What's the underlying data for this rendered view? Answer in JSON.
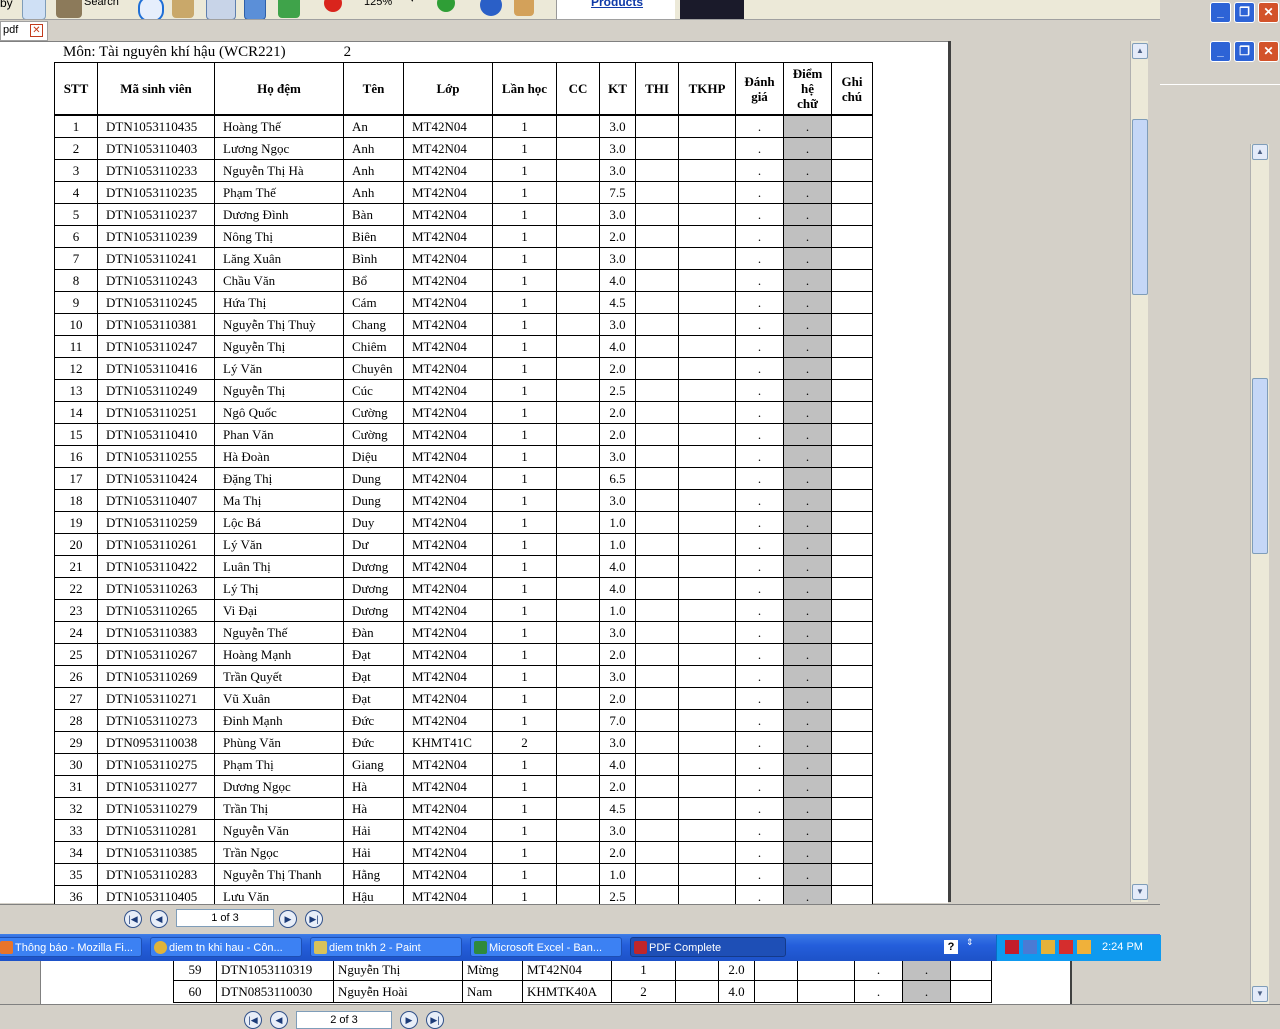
{
  "toolbar": {
    "left_fragment": "by",
    "search_label": "Search",
    "zoom": "125%",
    "products_link": "Products"
  },
  "doc_tab": {
    "label": "pdf",
    "close": "✕"
  },
  "document": {
    "subject": "Môn: Tài nguyên khí hậu (WCR221)",
    "page_number": "2",
    "headers": {
      "stt": "STT",
      "student_id": "Mã sinh viên",
      "surname": "Họ đệm",
      "name": "Tên",
      "class": "Lớp",
      "attempt": "Lần học",
      "cc": "CC",
      "kt": "KT",
      "thi": "THI",
      "tkhp": "TKHP",
      "rating_1": "Đánh",
      "rating_2": "giá",
      "letter_1": "Điểm",
      "letter_2": "hệ",
      "letter_3": "chữ",
      "note_1": "Ghi",
      "note_2": "chú"
    },
    "rows": [
      {
        "stt": "1",
        "id": "DTN1053110435",
        "surname": "Hoàng Thế",
        "name": "An",
        "class": "MT42N04",
        "attempt": "1",
        "kt": "3.0",
        "rating": ".",
        "letter": "."
      },
      {
        "stt": "2",
        "id": "DTN1053110403",
        "surname": "Lương Ngọc",
        "name": "Anh",
        "class": "MT42N04",
        "attempt": "1",
        "kt": "3.0",
        "rating": ".",
        "letter": "."
      },
      {
        "stt": "3",
        "id": "DTN1053110233",
        "surname": "Nguyễn Thị Hà",
        "name": "Anh",
        "class": "MT42N04",
        "attempt": "1",
        "kt": "3.0",
        "rating": ".",
        "letter": "."
      },
      {
        "stt": "4",
        "id": "DTN1053110235",
        "surname": "Phạm Thế",
        "name": "Anh",
        "class": "MT42N04",
        "attempt": "1",
        "kt": "7.5",
        "rating": ".",
        "letter": "."
      },
      {
        "stt": "5",
        "id": "DTN1053110237",
        "surname": "Dương Đình",
        "name": "Bàn",
        "class": "MT42N04",
        "attempt": "1",
        "kt": "3.0",
        "rating": ".",
        "letter": "."
      },
      {
        "stt": "6",
        "id": "DTN1053110239",
        "surname": "Nông Thị",
        "name": "Biên",
        "class": "MT42N04",
        "attempt": "1",
        "kt": "2.0",
        "rating": ".",
        "letter": "."
      },
      {
        "stt": "7",
        "id": "DTN1053110241",
        "surname": "Lăng Xuân",
        "name": "Bình",
        "class": "MT42N04",
        "attempt": "1",
        "kt": "3.0",
        "rating": ".",
        "letter": "."
      },
      {
        "stt": "8",
        "id": "DTN1053110243",
        "surname": "Chầu Văn",
        "name": "Bổ",
        "class": "MT42N04",
        "attempt": "1",
        "kt": "4.0",
        "rating": ".",
        "letter": "."
      },
      {
        "stt": "9",
        "id": "DTN1053110245",
        "surname": "Hứa Thị",
        "name": "Cám",
        "class": "MT42N04",
        "attempt": "1",
        "kt": "4.5",
        "rating": ".",
        "letter": "."
      },
      {
        "stt": "10",
        "id": "DTN1053110381",
        "surname": "Nguyễn Thị Thuỳ",
        "name": "Chang",
        "class": "MT42N04",
        "attempt": "1",
        "kt": "3.0",
        "rating": ".",
        "letter": "."
      },
      {
        "stt": "11",
        "id": "DTN1053110247",
        "surname": "Nguyễn Thị",
        "name": "Chiêm",
        "class": "MT42N04",
        "attempt": "1",
        "kt": "4.0",
        "rating": ".",
        "letter": "."
      },
      {
        "stt": "12",
        "id": "DTN1053110416",
        "surname": "Lý Văn",
        "name": "Chuyên",
        "class": "MT42N04",
        "attempt": "1",
        "kt": "2.0",
        "rating": ".",
        "letter": "."
      },
      {
        "stt": "13",
        "id": "DTN1053110249",
        "surname": "Nguyễn Thị",
        "name": "Cúc",
        "class": "MT42N04",
        "attempt": "1",
        "kt": "2.5",
        "rating": ".",
        "letter": "."
      },
      {
        "stt": "14",
        "id": "DTN1053110251",
        "surname": "Ngô Quốc",
        "name": "Cường",
        "class": "MT42N04",
        "attempt": "1",
        "kt": "2.0",
        "rating": ".",
        "letter": "."
      },
      {
        "stt": "15",
        "id": "DTN1053110410",
        "surname": "Phan Văn",
        "name": "Cường",
        "class": "MT42N04",
        "attempt": "1",
        "kt": "2.0",
        "rating": ".",
        "letter": "."
      },
      {
        "stt": "16",
        "id": "DTN1053110255",
        "surname": "Hà Đoàn",
        "name": "Diệu",
        "class": "MT42N04",
        "attempt": "1",
        "kt": "3.0",
        "rating": ".",
        "letter": "."
      },
      {
        "stt": "17",
        "id": "DTN1053110424",
        "surname": "Đặng Thị",
        "name": "Dung",
        "class": "MT42N04",
        "attempt": "1",
        "kt": "6.5",
        "rating": ".",
        "letter": "."
      },
      {
        "stt": "18",
        "id": "DTN1053110407",
        "surname": "Ma Thị",
        "name": "Dung",
        "class": "MT42N04",
        "attempt": "1",
        "kt": "3.0",
        "rating": ".",
        "letter": "."
      },
      {
        "stt": "19",
        "id": "DTN1053110259",
        "surname": "Lộc Bá",
        "name": "Duy",
        "class": "MT42N04",
        "attempt": "1",
        "kt": "1.0",
        "rating": ".",
        "letter": "."
      },
      {
        "stt": "20",
        "id": "DTN1053110261",
        "surname": "Lý Văn",
        "name": "Dư",
        "class": "MT42N04",
        "attempt": "1",
        "kt": "1.0",
        "rating": ".",
        "letter": "."
      },
      {
        "stt": "21",
        "id": "DTN1053110422",
        "surname": "Luân Thị",
        "name": "Dương",
        "class": "MT42N04",
        "attempt": "1",
        "kt": "4.0",
        "rating": ".",
        "letter": "."
      },
      {
        "stt": "22",
        "id": "DTN1053110263",
        "surname": "Lý Thị",
        "name": "Dương",
        "class": "MT42N04",
        "attempt": "1",
        "kt": "4.0",
        "rating": ".",
        "letter": "."
      },
      {
        "stt": "23",
        "id": "DTN1053110265",
        "surname": "Vi Đại",
        "name": "Dương",
        "class": "MT42N04",
        "attempt": "1",
        "kt": "1.0",
        "rating": ".",
        "letter": "."
      },
      {
        "stt": "24",
        "id": "DTN1053110383",
        "surname": "Nguyễn Thế",
        "name": "Đàn",
        "class": "MT42N04",
        "attempt": "1",
        "kt": "3.0",
        "rating": ".",
        "letter": "."
      },
      {
        "stt": "25",
        "id": "DTN1053110267",
        "surname": "Hoàng Mạnh",
        "name": "Đạt",
        "class": "MT42N04",
        "attempt": "1",
        "kt": "2.0",
        "rating": ".",
        "letter": "."
      },
      {
        "stt": "26",
        "id": "DTN1053110269",
        "surname": "Trần Quyết",
        "name": "Đạt",
        "class": "MT42N04",
        "attempt": "1",
        "kt": "3.0",
        "rating": ".",
        "letter": "."
      },
      {
        "stt": "27",
        "id": "DTN1053110271",
        "surname": "Vũ Xuân",
        "name": "Đạt",
        "class": "MT42N04",
        "attempt": "1",
        "kt": "2.0",
        "rating": ".",
        "letter": "."
      },
      {
        "stt": "28",
        "id": "DTN1053110273",
        "surname": "Đinh Mạnh",
        "name": "Đức",
        "class": "MT42N04",
        "attempt": "1",
        "kt": "7.0",
        "rating": ".",
        "letter": "."
      },
      {
        "stt": "29",
        "id": "DTN0953110038",
        "surname": "Phùng Văn",
        "name": "Đức",
        "class": "KHMT41C",
        "attempt": "2",
        "kt": "3.0",
        "rating": ".",
        "letter": "."
      },
      {
        "stt": "30",
        "id": "DTN1053110275",
        "surname": "Phạm Thị",
        "name": "Giang",
        "class": "MT42N04",
        "attempt": "1",
        "kt": "4.0",
        "rating": ".",
        "letter": "."
      },
      {
        "stt": "31",
        "id": "DTN1053110277",
        "surname": "Dương Ngọc",
        "name": "Hà",
        "class": "MT42N04",
        "attempt": "1",
        "kt": "2.0",
        "rating": ".",
        "letter": "."
      },
      {
        "stt": "32",
        "id": "DTN1053110279",
        "surname": "Trần Thị",
        "name": "Hà",
        "class": "MT42N04",
        "attempt": "1",
        "kt": "4.5",
        "rating": ".",
        "letter": "."
      },
      {
        "stt": "33",
        "id": "DTN1053110281",
        "surname": "Nguyễn Văn",
        "name": "Hải",
        "class": "MT42N04",
        "attempt": "1",
        "kt": "3.0",
        "rating": ".",
        "letter": "."
      },
      {
        "stt": "34",
        "id": "DTN1053110385",
        "surname": "Trần Ngọc",
        "name": "Hải",
        "class": "MT42N04",
        "attempt": "1",
        "kt": "2.0",
        "rating": ".",
        "letter": "."
      },
      {
        "stt": "35",
        "id": "DTN1053110283",
        "surname": "Nguyễn Thị Thanh",
        "name": "Hằng",
        "class": "MT42N04",
        "attempt": "1",
        "kt": "1.0",
        "rating": ".",
        "letter": "."
      },
      {
        "stt": "36",
        "id": "DTN1053110405",
        "surname": "Lưu Văn",
        "name": "Hậu",
        "class": "MT42N04",
        "attempt": "1",
        "kt": "2.5",
        "rating": ".",
        "letter": "."
      }
    ]
  },
  "nav": {
    "page_indicator": "1 of 3"
  },
  "taskbar": {
    "items": [
      {
        "label": "Thông báo - Mozilla Fi..."
      },
      {
        "label": "diem tn khi hau - Côn..."
      },
      {
        "label": "diem tnkh 2 - Paint"
      },
      {
        "label": "Microsoft Excel - Ban..."
      },
      {
        "label": "PDF Complete"
      }
    ],
    "help": "?",
    "clock": "2:24 PM"
  },
  "back_window": {
    "rows": [
      {
        "stt": "59",
        "id": "DTN1053110319",
        "surname": "Nguyễn Thị",
        "name": "Mừng",
        "class": "MT42N04",
        "attempt": "1",
        "kt": "2.0",
        "rating": ".",
        "letter": "."
      },
      {
        "stt": "60",
        "id": "DTN0853110030",
        "surname": "Nguyễn Hoài",
        "name": "Nam",
        "class": "KHMTK40A",
        "attempt": "2",
        "kt": "4.0",
        "rating": ".",
        "letter": "."
      }
    ],
    "page_indicator": "2 of 3"
  },
  "colors": {
    "taskbar": "#245edb",
    "tray": "#0f9aef",
    "letter_grade_cell": "#c0c0c0",
    "window_chrome": "#d4d0c8"
  }
}
